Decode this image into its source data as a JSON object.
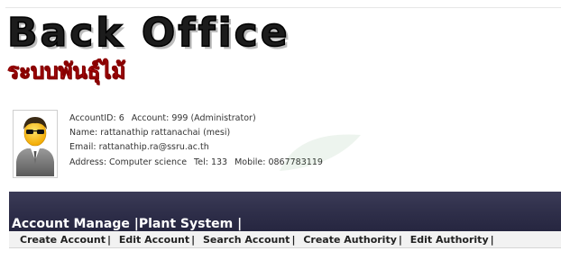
{
  "logo": {
    "title": "Back Office",
    "subtitle": "ระบบพันธุ์ไม้"
  },
  "profile": {
    "account_id": "AccountID: 6",
    "account": "Account: 999 (Administrator)",
    "name": "Name: rattanathip  rattanachai (mesi)",
    "email": "Email: rattanathip.ra@ssru.ac.th",
    "address": "Address: Computer science",
    "tel": "Tel: 133",
    "mobile": "Mobile: 0867783119"
  },
  "menu": {
    "account_manage": "Account Manage",
    "plant_system": "Plant System",
    "separator": "|"
  },
  "submenu": {
    "items": [
      "Create Account",
      "Edit Account",
      "Search Account",
      "Create Authority",
      "Edit Authority"
    ],
    "separator": "|"
  },
  "colors": {
    "menu_bar": "#2e2e49",
    "logo_subtitle": "#c4161c"
  }
}
